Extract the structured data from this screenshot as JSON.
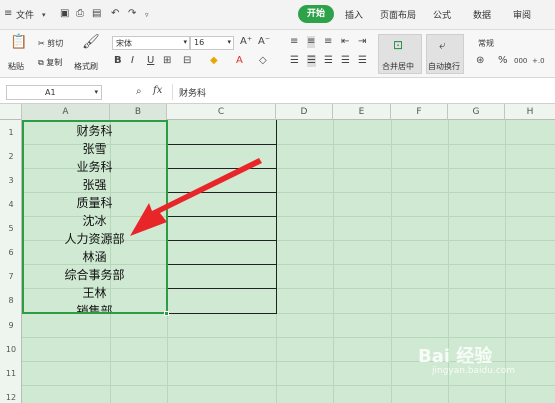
{
  "menu": {
    "file": "文件",
    "tabs": [
      "开始",
      "插入",
      "页面布局",
      "公式",
      "数据",
      "审阅"
    ]
  },
  "ribbon": {
    "paste": "粘贴",
    "cut": "剪切",
    "copy": "复制",
    "format_painter": "格式刷",
    "font_name": "宋体",
    "font_size": "16",
    "merge_center": "合并居中",
    "wrap_text": "自动换行",
    "number_format": "常规"
  },
  "formula_bar": {
    "cell_ref": "A1",
    "fx": "fx",
    "content": "财务科"
  },
  "columns": [
    "A",
    "B",
    "C",
    "D",
    "E",
    "F",
    "G",
    "H"
  ],
  "rows": [
    "1",
    "2",
    "3",
    "4",
    "5",
    "6",
    "7",
    "8",
    "9",
    "10",
    "11",
    "12"
  ],
  "cells": [
    "财务科",
    "张雪",
    "业务科",
    "张强",
    "质量科",
    "沈冰",
    "人力资源部",
    "林涵",
    "综合事务部",
    "王林",
    "销售部"
  ],
  "watermark": {
    "brand": "Bai 经验",
    "url": "jingyan.baidu.com"
  },
  "colors": {
    "accent": "#2ea24a",
    "grid_bg": "#cfe9d2",
    "arrow": "#e8262a"
  }
}
